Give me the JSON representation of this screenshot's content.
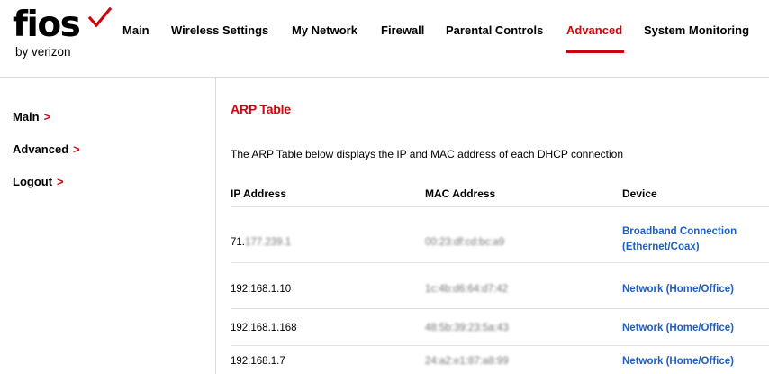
{
  "brand": {
    "wordmark": "fios",
    "sub": "by verizon",
    "accent_color": "#cd040b",
    "link_color": "#1f5fbf"
  },
  "nav": {
    "items": [
      {
        "label": "Main"
      },
      {
        "label": "Wireless Settings"
      },
      {
        "label": "My Network"
      },
      {
        "label": "Firewall"
      },
      {
        "label": "Parental Controls"
      },
      {
        "label": "Advanced",
        "active": true
      },
      {
        "label": "System Monitoring"
      }
    ]
  },
  "sidebar": {
    "items": [
      {
        "label": "Main",
        "icon": "chevron-right-icon"
      },
      {
        "label": "Advanced",
        "icon": "chevron-right-icon"
      },
      {
        "label": "Logout",
        "icon": "chevron-right-icon"
      }
    ]
  },
  "main": {
    "title": "ARP Table",
    "description": "The ARP Table below displays the IP and MAC address of each DHCP connection",
    "table": {
      "headers": [
        "IP Address",
        "MAC Address",
        "Device"
      ],
      "rows": [
        {
          "ip_prefix": "71.",
          "ip_rest": "177.239.1",
          "mac": "00:23:df:cd:bc:a9",
          "device_line1": "Broadband Connection",
          "device_line2": "(Ethernet/Coax)"
        },
        {
          "ip_prefix": "192.168.1.10",
          "ip_rest": "",
          "mac": "1c:4b:d6:64:d7:42",
          "device_line1": "Network (Home/Office)",
          "device_line2": ""
        },
        {
          "ip_prefix": "192.168.1.168",
          "ip_rest": "",
          "mac": "48:5b:39:23:5a:43",
          "device_line1": "Network (Home/Office)",
          "device_line2": ""
        },
        {
          "ip_prefix": "192.168.1.7",
          "ip_rest": "",
          "mac": "24:a2:e1:87:a8:99",
          "device_line1": "Network (Home/Office)",
          "device_line2": ""
        }
      ]
    }
  }
}
